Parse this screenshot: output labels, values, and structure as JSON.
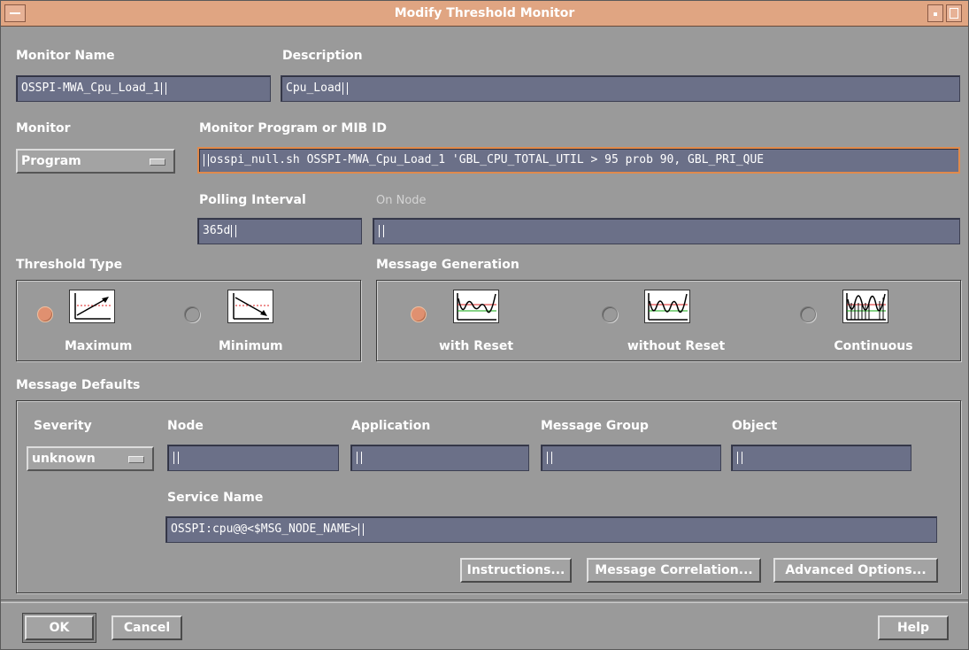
{
  "window": {
    "title": "Modify Threshold Monitor"
  },
  "labels": {
    "monitor_name": "Monitor Name",
    "description": "Description",
    "monitor": "Monitor",
    "program_id": "Monitor Program or MIB ID",
    "polling_interval": "Polling Interval",
    "on_node": "On Node",
    "threshold_type": "Threshold Type",
    "message_generation": "Message Generation",
    "message_defaults": "Message Defaults",
    "severity": "Severity",
    "node": "Node",
    "application": "Application",
    "message_group": "Message Group",
    "object": "Object",
    "service_name": "Service Name"
  },
  "fields": {
    "monitor_name": "OSSPI-MWA_Cpu_Load_1",
    "description": "Cpu_Load",
    "program_id": "osspi_null.sh OSSPI-MWA_Cpu_Load_1 'GBL_CPU_TOTAL_UTIL > 95 prob 90, GBL_PRI_QUE",
    "polling_interval": "365d",
    "on_node": "",
    "node": "",
    "application": "",
    "message_group": "",
    "object": "",
    "service_name": "OSSPI:cpu@@<$MSG_NODE_NAME>"
  },
  "selects": {
    "monitor": "Program",
    "severity": "unknown"
  },
  "threshold_type": {
    "options": [
      {
        "label": "Maximum",
        "selected": true,
        "icon": "max-threshold-icon"
      },
      {
        "label": "Minimum",
        "selected": false,
        "icon": "min-threshold-icon"
      }
    ]
  },
  "message_generation": {
    "options": [
      {
        "label": "with Reset",
        "selected": true,
        "icon": "with-reset-icon"
      },
      {
        "label": "without Reset",
        "selected": false,
        "icon": "without-reset-icon"
      },
      {
        "label": "Continuous",
        "selected": false,
        "icon": "continuous-icon"
      }
    ]
  },
  "buttons": {
    "instructions": "Instructions...",
    "message_correlation": "Message Correlation...",
    "advanced_options": "Advanced Options...",
    "ok": "OK",
    "cancel": "Cancel",
    "help": "Help"
  },
  "colors": {
    "titlebar": "#e0a582",
    "field_bg": "#6b7088",
    "window_bg": "#9a9a9a",
    "radio_on": "#e09070"
  }
}
